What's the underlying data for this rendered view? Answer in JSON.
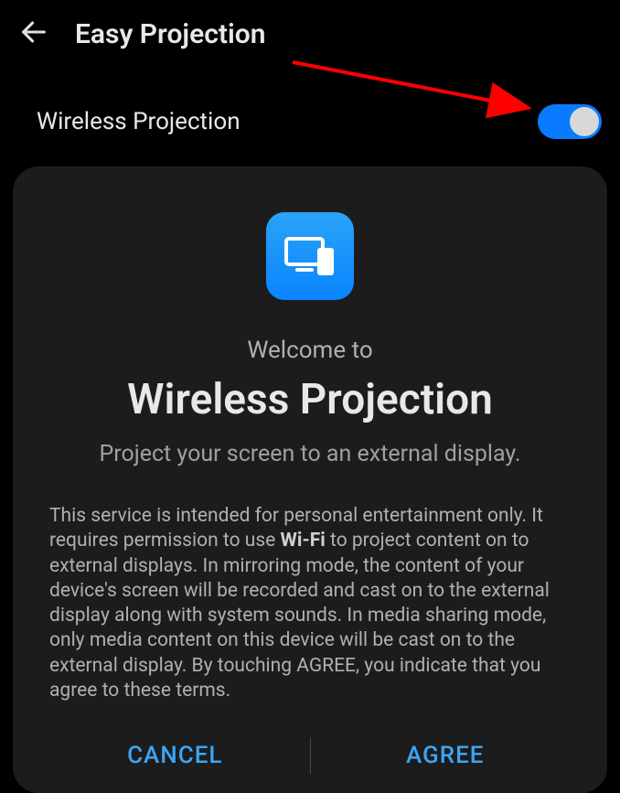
{
  "header": {
    "title": "Easy Projection"
  },
  "setting": {
    "label": "Wireless Projection",
    "enabled": true
  },
  "dialog": {
    "welcome": "Welcome to",
    "title": "Wireless Projection",
    "subtitle": "Project your screen to an external display.",
    "body_part1": "This service is intended for personal entertainment only. It requires permission to use ",
    "body_bold": "Wi-Fi",
    "body_part2": " to project content on to external displays. In mirroring mode, the content of your device's screen will be recorded and cast on to the external display along with system sounds. In media sharing mode, only media content on this device will be cast on to the external display. By touching AGREE, you indicate that you agree to these terms.",
    "cancel_label": "CANCEL",
    "agree_label": "AGREE"
  },
  "icons": {
    "back": "back-arrow",
    "projection": "projection-icon"
  },
  "colors": {
    "accent": "#0a84ff",
    "arrow": "#ff0000"
  }
}
